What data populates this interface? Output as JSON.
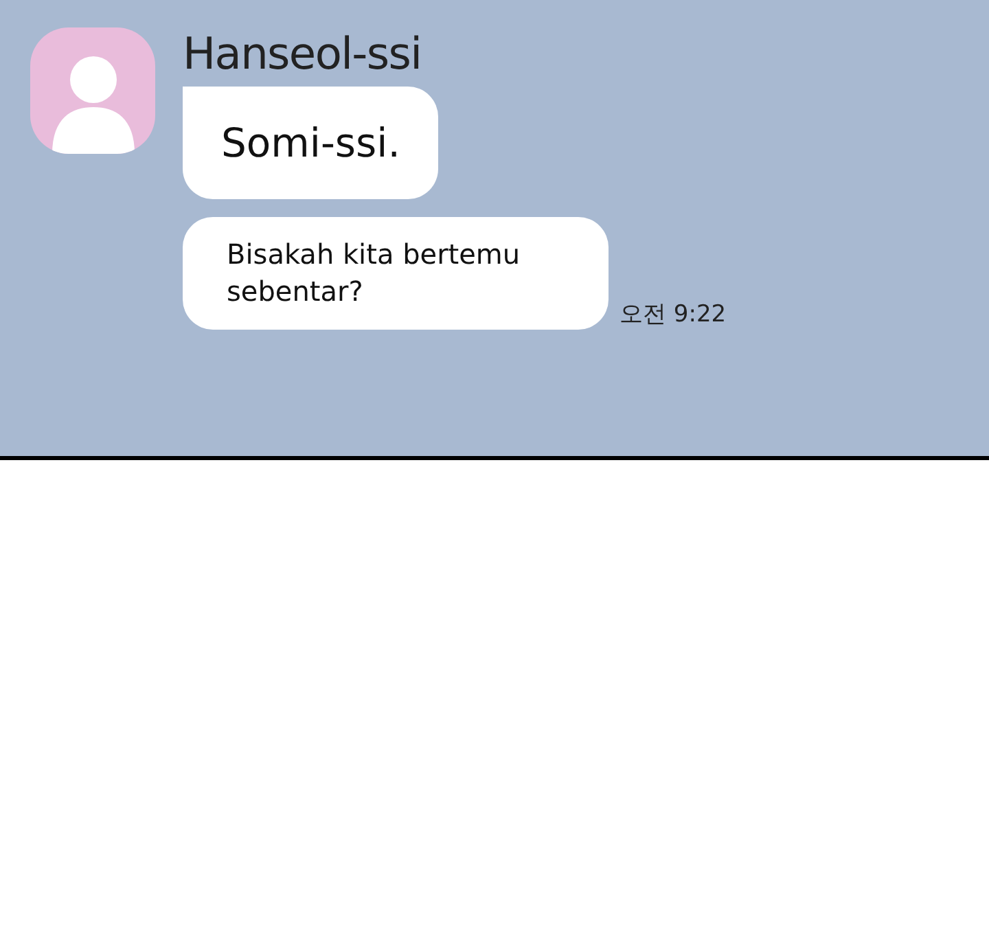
{
  "sender": {
    "name": "Hanseol-ssi"
  },
  "messages": [
    {
      "text": "Somi-ssi.",
      "kind": "large"
    },
    {
      "text": "Bisakah kita bertemu sebentar?",
      "kind": "normal",
      "time": "오전 9:22"
    }
  ]
}
